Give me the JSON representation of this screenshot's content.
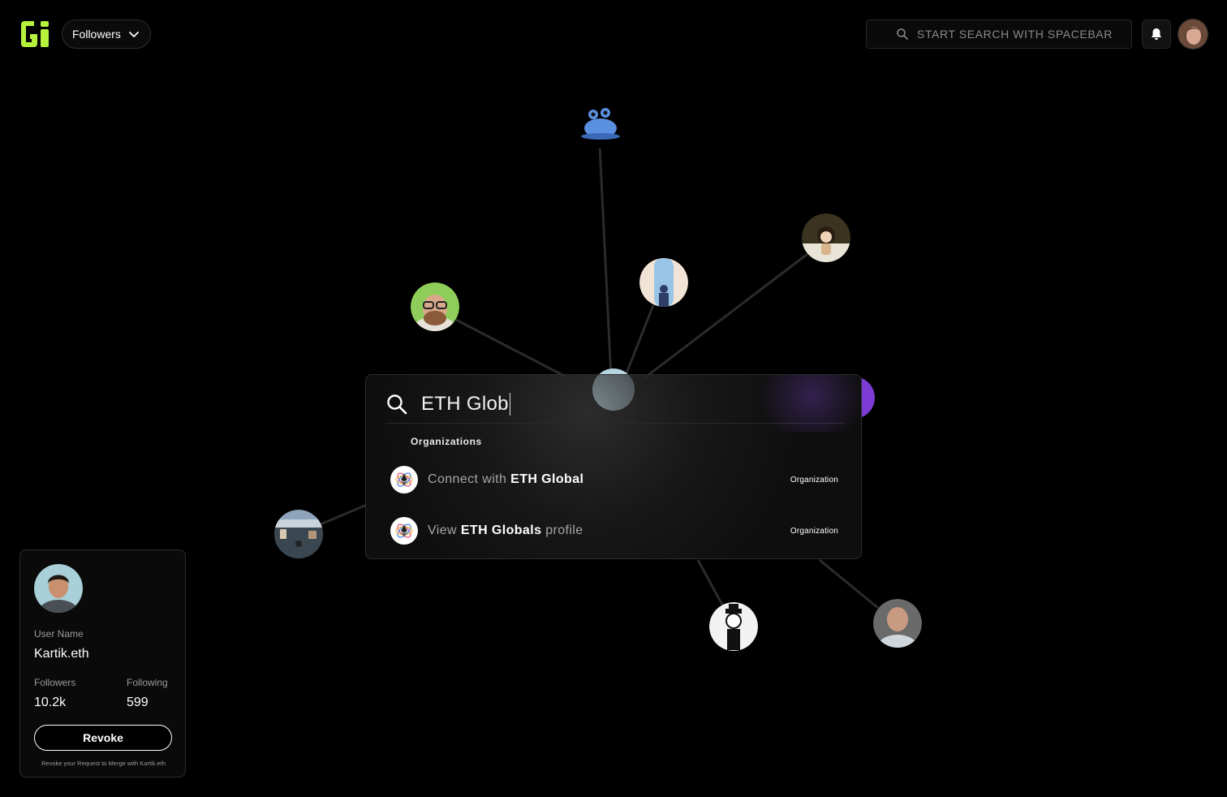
{
  "header": {
    "filter_label": "Followers",
    "search_placeholder": "START SEARCH WITH SPACEBAR"
  },
  "palette": {
    "query": "ETH Glob",
    "section_label": "Organizations",
    "results": [
      {
        "prefix": "Connect with ",
        "bold": "ETH Global",
        "suffix": "",
        "badge": "Organization"
      },
      {
        "prefix": "View ",
        "bold": "ETH Globals",
        "suffix": " profile",
        "badge": "Organization"
      }
    ]
  },
  "profile": {
    "username_label": "User Name",
    "username": "Kartik.eth",
    "followers_label": "Followers",
    "followers": "10.2k",
    "following_label": "Following",
    "following": "599",
    "revoke_label": "Revoke",
    "revoke_note": "Revoke your Request to Merge with Kartik.eth"
  },
  "colors": {
    "brand": "#b6f23c",
    "background": "#000000",
    "graph_edge": "#2b2b2b"
  }
}
